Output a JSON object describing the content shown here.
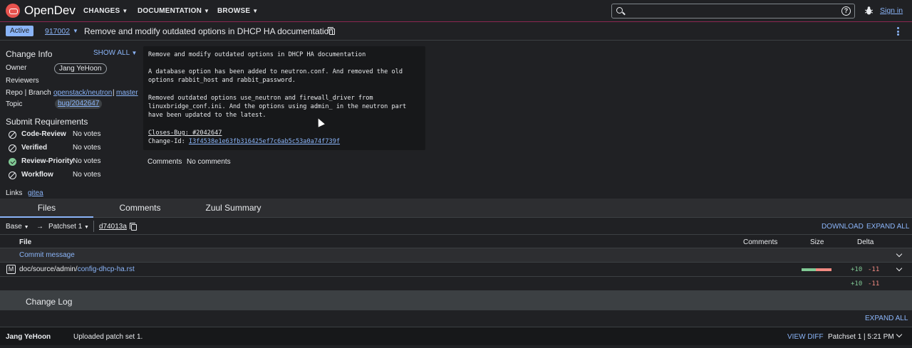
{
  "header": {
    "brand": "OpenDev",
    "nav": [
      {
        "label": "CHANGES"
      },
      {
        "label": "DOCUMENTATION"
      },
      {
        "label": "BROWSE"
      }
    ],
    "search_placeholder": "",
    "signin": "Sign in",
    "help_glyph": "?"
  },
  "change": {
    "status": "Active",
    "number": "917002",
    "title": "Remove and modify outdated options in DHCP HA documentation"
  },
  "info": {
    "title": "Change Info",
    "show_all": "SHOW ALL",
    "owner_label": "Owner",
    "owner": "Jang YeHoon",
    "reviewers_label": "Reviewers",
    "repo_label": "Repo | Branch",
    "repo": "openstack/neutron",
    "separator": "|",
    "branch": "master",
    "topic_label": "Topic",
    "topic": "bug/2042647"
  },
  "submit_requirements": {
    "title": "Submit Requirements",
    "items": [
      {
        "name": "Code-Review",
        "votes": "No votes",
        "state": "block"
      },
      {
        "name": "Verified",
        "votes": "No votes",
        "state": "block"
      },
      {
        "name": "Review-Priority",
        "votes": "No votes",
        "state": "ok"
      },
      {
        "name": "Workflow",
        "votes": "No votes",
        "state": "block"
      }
    ]
  },
  "links": {
    "label": "Links",
    "gitea": "gitea"
  },
  "commit_message": {
    "lines": [
      "Remove and modify outdated options in DHCP HA documentation",
      "",
      "A database option has been added to neutron.conf. And removed the old",
      "options rabbit_host and rabbit_password.",
      "",
      "Removed outdated options use_neutron and firewall_driver from",
      "linuxbridge_conf.ini. And the options using admin_ in the neutron part",
      "have been updated to the latest.",
      ""
    ],
    "closes_bug": "Closes-Bug: #2042647",
    "change_id_label": "Change-Id: ",
    "change_id": "I3f4538e1e63fb316425ef7c6ab5c53a0a74f739f"
  },
  "comments": {
    "label": "Comments",
    "value": "No comments"
  },
  "tabs": [
    {
      "label": "Files"
    },
    {
      "label": "Comments"
    },
    {
      "label": "Zuul Summary"
    }
  ],
  "files": {
    "base": "Base",
    "arrow": "→",
    "patchset": "Patchset 1",
    "commit": "d74013a",
    "download": "DOWNLOAD",
    "expand_all": "EXPAND ALL",
    "columns": {
      "file": "File",
      "comments": "Comments",
      "size": "Size",
      "delta": "Delta"
    },
    "commit_message_row": "Commit message",
    "rows": [
      {
        "status": "M",
        "path": "doc/source/admin/",
        "name": "config-dhcp-ha.rst",
        "plus": "+10",
        "minus": "-11"
      }
    ],
    "total_plus": "+10",
    "total_minus": "-11"
  },
  "changelog": {
    "title": "Change Log",
    "expand_all": "EXPAND ALL",
    "entries": [
      {
        "author": "Jang YeHoon",
        "message": "Uploaded patch set 1.",
        "view_diff": "VIEW DIFF",
        "meta": "Patchset 1 | 5:21 PM"
      }
    ]
  }
}
